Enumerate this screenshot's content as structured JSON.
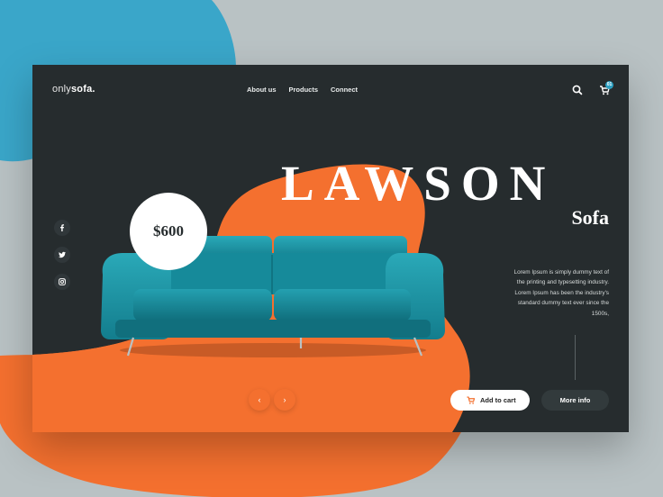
{
  "brand": {
    "prefix": "only",
    "name": "sofa."
  },
  "nav": {
    "items": [
      "About us",
      "Products",
      "Connect"
    ]
  },
  "header": {
    "search_icon": "search-icon",
    "cart_icon": "cart-icon",
    "cart_count": "01"
  },
  "social": [
    "facebook-icon",
    "twitter-icon",
    "instagram-icon"
  ],
  "hero": {
    "title": "LAWSON",
    "subtitle": "Sofa",
    "price": "$600",
    "description": "Lorem Ipsum is simply dummy text of the printing and typesetting industry. Lorem Ipsum has been the industry's standard dummy text ever since the 1500s,"
  },
  "carousel": {
    "prev": "‹",
    "next": "›"
  },
  "actions": {
    "add_to_cart": "Add to cart",
    "more_info": "More info"
  },
  "colors": {
    "blue": "#3aa6c9",
    "orange": "#f4702f",
    "dark": "#262c2e",
    "sofa": "#1e8fa0"
  }
}
